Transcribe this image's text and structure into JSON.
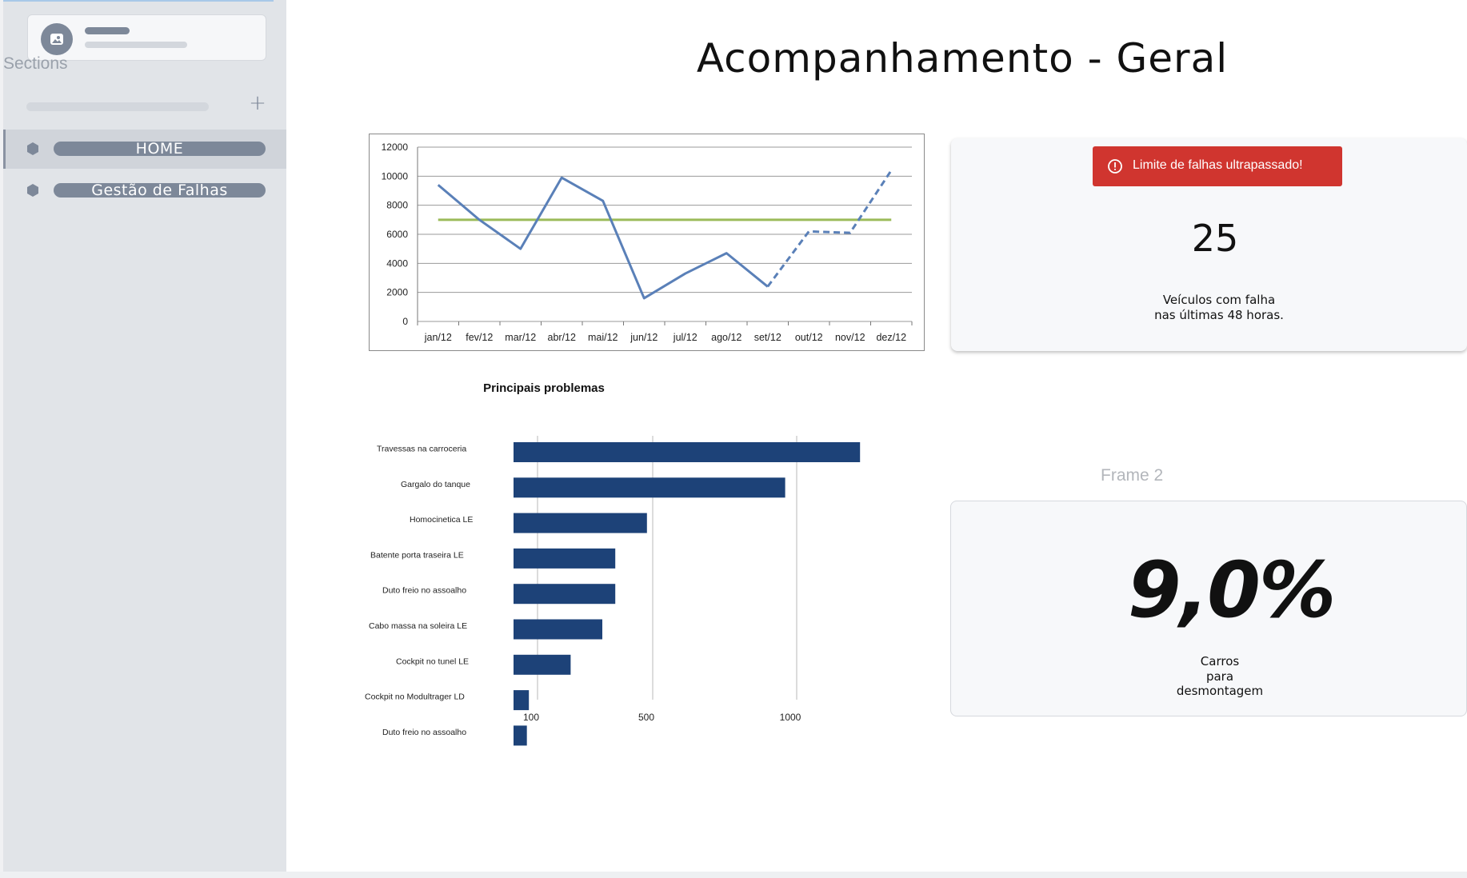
{
  "sidebar": {
    "sections_label": "Sections",
    "items": [
      {
        "label": "HOME",
        "active": true
      },
      {
        "label": "Gestão de Falhas",
        "active": false
      }
    ]
  },
  "page": {
    "title": "Acompanhamento - Geral"
  },
  "alert_card": {
    "alert_text": "Limite de falhas ultrapassado!",
    "value": "25",
    "caption_line1": "Veículos com falha",
    "caption_line2": "nas últimas 48 horas."
  },
  "frame_label": "Frame 2",
  "percent_card": {
    "value": "9,0%",
    "caption_line1": "Carros",
    "caption_line2": "para",
    "caption_line3": "desmontagem"
  },
  "colors": {
    "sidebar_bg": "#e1e4e8",
    "nav_pill": "#7d8899",
    "alert_red": "#d0352f",
    "line_series": "#5a80b8",
    "target_line": "#9bbb59",
    "bar_fill": "#1d4278"
  },
  "chart_data": [
    {
      "type": "line",
      "title": "",
      "xlabel": "",
      "ylabel": "",
      "categories": [
        "jan/12",
        "fev/12",
        "mar/12",
        "abr/12",
        "mai/12",
        "jun/12",
        "jul/12",
        "ago/12",
        "set/12",
        "out/12",
        "nov/12",
        "dez/12"
      ],
      "series": [
        {
          "values": [
            9400,
            7000,
            5000,
            9900,
            8300,
            1600,
            3300,
            4700,
            2400,
            6200,
            6100,
            10400
          ],
          "dashed_from_index": 8
        },
        {
          "values": [
            7000,
            7000,
            7000,
            7000,
            7000,
            7000,
            7000,
            7000,
            7000,
            7000,
            7000,
            7000
          ]
        }
      ],
      "yticks": [
        "0",
        "2000",
        "4000",
        "6000",
        "8000",
        "10000",
        "12000"
      ],
      "ylim": [
        0,
        12000
      ],
      "grid": true,
      "legend": "none"
    },
    {
      "type": "bar",
      "orientation": "horizontal",
      "title": "Principais problemas",
      "xlabel": "",
      "ylabel": "",
      "categories": [
        "Travessas na carroceria",
        "Gargalo do tanque",
        "Homocinetica LE",
        "Batente porta traseira LE",
        "Duto freio no assoalho",
        "Cabo massa na soleira LE",
        "Cockpit no tunel LE",
        "Cockpit no Modultrager LD",
        "Duto freio no assoalho"
      ],
      "values": [
        1220,
        960,
        480,
        370,
        370,
        325,
        215,
        70,
        63
      ],
      "xticks": [
        "100",
        "500",
        "1000"
      ],
      "grid": true,
      "legend": "none"
    }
  ]
}
